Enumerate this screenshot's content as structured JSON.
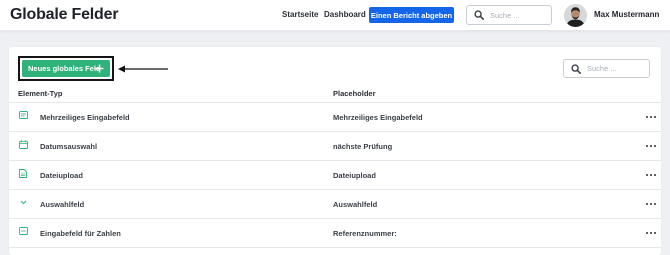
{
  "header": {
    "title": "Globale Felder",
    "nav": [
      "Startseite",
      "Dashboard"
    ],
    "report_button": "Einen Bericht abgeben",
    "search_placeholder": "Suche ...",
    "user_name": "Max Mustermann"
  },
  "main": {
    "new_field_button": "Neues globales Feld",
    "search_placeholder": "Suche ...",
    "columns": [
      "Element-Typ",
      "Placeholder"
    ],
    "rows": [
      {
        "icon": "multiline-textfield-icon",
        "type": "Mehrzeiliges Eingabefeld",
        "placeholder": "Mehrzeiliges Eingabefeld"
      },
      {
        "icon": "calendar-icon",
        "type": "Datumsauswahl",
        "placeholder": "nächste Prüfung"
      },
      {
        "icon": "file-icon",
        "type": "Dateiupload",
        "placeholder": "Dateiupload"
      },
      {
        "icon": "chevron-down-icon",
        "type": "Auswahlfeld",
        "placeholder": "Auswahlfeld"
      },
      {
        "icon": "number-field-icon",
        "type": "Eingabefeld für Zahlen",
        "placeholder": "Referenznummer:"
      }
    ]
  },
  "colors": {
    "primary_blue": "#1565e8",
    "accent_green": "#2fb37a",
    "background": "#eef0f3"
  }
}
